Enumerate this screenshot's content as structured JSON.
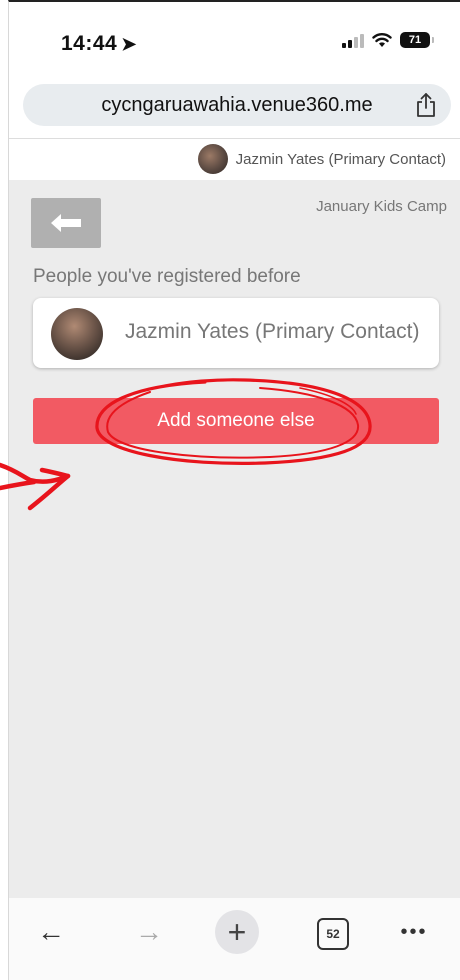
{
  "status_bar": {
    "time": "14:44",
    "battery": "71"
  },
  "browser": {
    "url": "cycngaruawahia.venue360.me"
  },
  "header": {
    "contact_name": "Jazmin Yates (Primary Contact)"
  },
  "main": {
    "event_title": "January Kids Camp",
    "section_label": "People you've registered before",
    "people": [
      {
        "name": "Jazmin Yates (Primary Contact)"
      }
    ],
    "add_button_label": "Add someone else"
  },
  "toolbar": {
    "tab_count": "52"
  },
  "colors": {
    "accent": "#f25a63",
    "annotation": "#e8141c",
    "background": "#ececec"
  }
}
